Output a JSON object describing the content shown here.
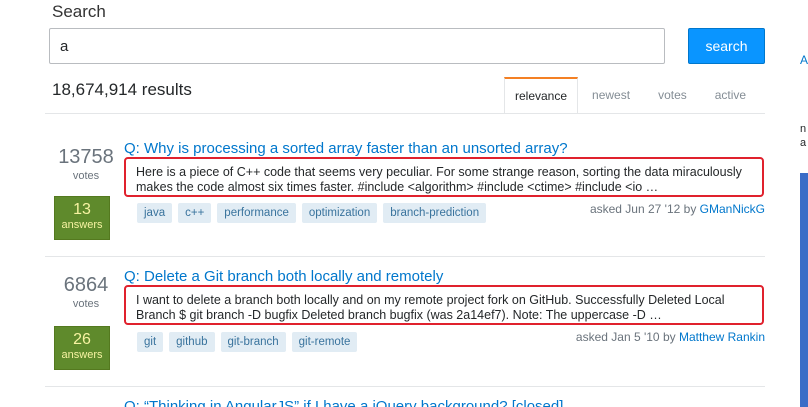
{
  "search": {
    "heading": "Search",
    "query": "a",
    "button_label": "search"
  },
  "results_count": "18,674,914 results",
  "sort_tabs": [
    {
      "label": "relevance",
      "active": true
    },
    {
      "label": "newest",
      "active": false
    },
    {
      "label": "votes",
      "active": false
    },
    {
      "label": "active",
      "active": false
    }
  ],
  "results": [
    {
      "votes": "13758",
      "votes_label": "votes",
      "answers": "13",
      "answers_label": "answers",
      "title": "Q: Why is processing a sorted array faster than an unsorted array?",
      "excerpt": "Here is a piece of C++ code that seems very peculiar. For some strange reason, sorting the data miraculously makes the code almost six times faster. #include <algorithm> #include <ctime> #include <io …",
      "tags": [
        "java",
        "c++",
        "performance",
        "optimization",
        "branch-prediction"
      ],
      "asked_prefix": "asked Jun 27 '12 by ",
      "user": "GManNickG"
    },
    {
      "votes": "6864",
      "votes_label": "votes",
      "answers": "26",
      "answers_label": "answers",
      "title": "Q: Delete a Git branch both locally and remotely",
      "excerpt": "I want to delete a branch both locally and on my remote project fork on GitHub. Successfully Deleted Local Branch $ git branch -D bugfix Deleted branch bugfix (was 2a14ef7). Note: The uppercase -D …",
      "tags": [
        "git",
        "github",
        "git-branch",
        "git-remote"
      ],
      "asked_prefix": "asked Jan 5 '10 by ",
      "user": "Matthew Rankin"
    },
    {
      "title": "Q: “Thinking in AngularJS” if I have a jQuery background? [closed]"
    }
  ],
  "sidebar": {
    "link_letter": "A",
    "text_line1": "n",
    "text_line2": "a"
  },
  "colors": {
    "accent": "#0a95ff",
    "link": "#0077cc",
    "answered": "#5f8a2c",
    "highlight": "#e0212d",
    "tab_active": "#f48024"
  }
}
